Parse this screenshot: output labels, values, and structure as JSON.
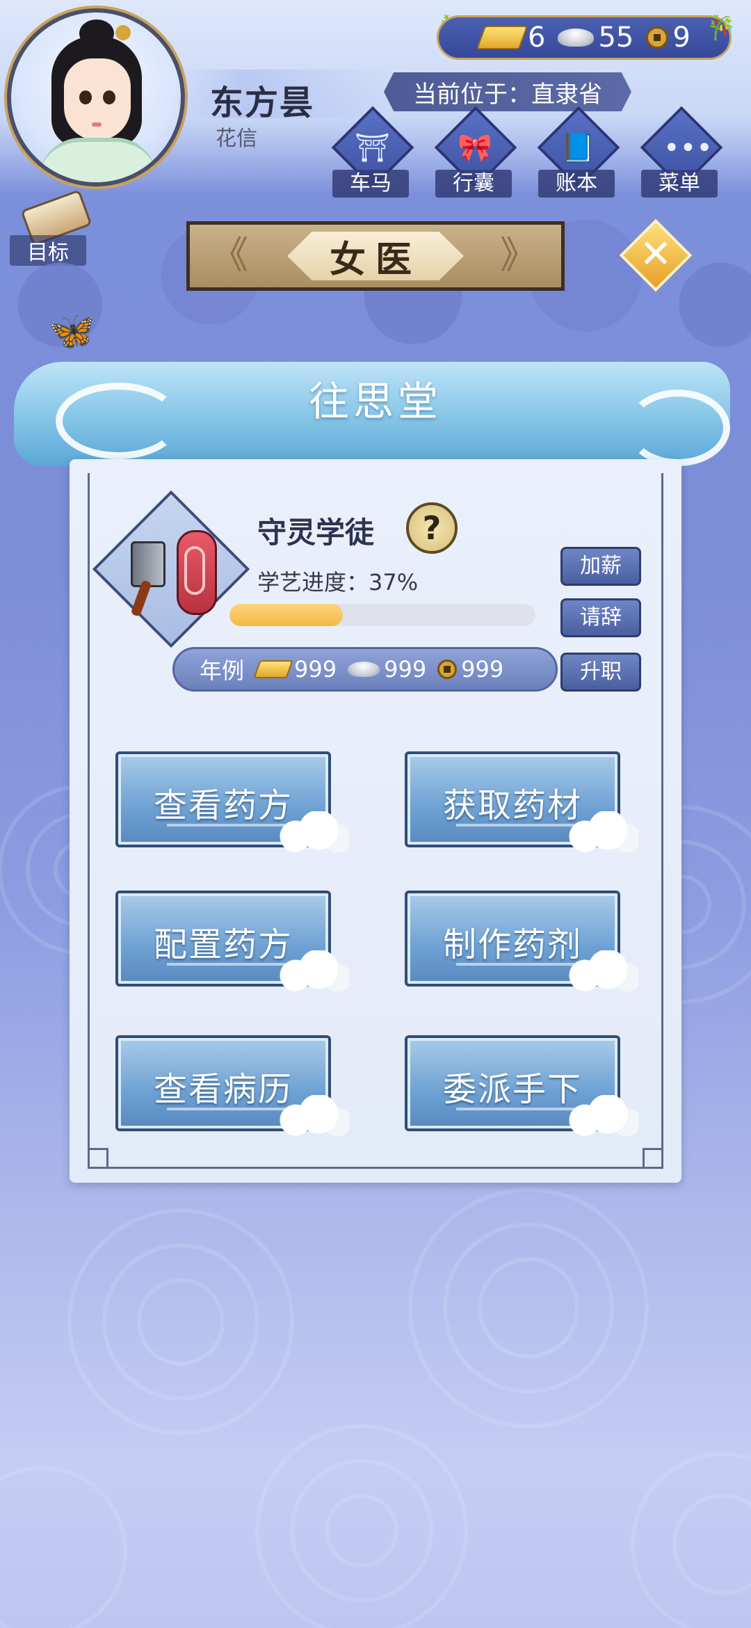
{
  "player": {
    "name": "东方昙",
    "subtitle": "花信"
  },
  "currency": {
    "gold": "6",
    "silver": "55",
    "coin": "9"
  },
  "location": "当前位于：直隶省",
  "nav": [
    {
      "label": "车马",
      "icon": "carriage-icon"
    },
    {
      "label": "行囊",
      "icon": "bundle-icon"
    },
    {
      "label": "账本",
      "icon": "ledger-icon"
    },
    {
      "label": "菜单",
      "icon": "menu-dots-icon"
    }
  ],
  "target_label": "目标",
  "page_title": "女医",
  "hall_title": "往思堂",
  "role": {
    "name": "守灵学徒",
    "progress_text": "学艺进度：37%",
    "progress": 0.37
  },
  "side_buttons": {
    "raise": "加薪",
    "resign": "请辞",
    "promote": "升职"
  },
  "salary": {
    "label": "年例",
    "gold": "999",
    "silver": "999",
    "coin": "999"
  },
  "actions": [
    "查看药方",
    "获取药材",
    "配置药方",
    "制作药剂",
    "查看病历",
    "委派手下"
  ],
  "colors": {
    "accent_gold": "#e6a02a",
    "panel_bg": "#e4ebf8",
    "progress": "#f2b947"
  }
}
